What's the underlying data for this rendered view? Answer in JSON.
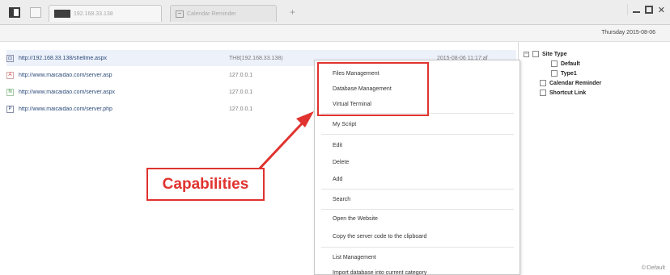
{
  "titlebar": {
    "tabs": [
      {
        "label": "192.168.33.138"
      },
      {
        "label": "Calendar Reminder"
      }
    ],
    "new_tab": "+"
  },
  "date_bar": {
    "date": "Thursday 2015-08-06"
  },
  "sites": [
    {
      "url": "http://192.168.33.138/shellme.aspx",
      "ip": "TH8(192.168.33.138)",
      "date": "2015-08-06 11:17:af",
      "icon": "aspx-icon",
      "selected": true
    },
    {
      "url": "http://www.maicaidao.com/server.asp",
      "ip": "127.0.0.1",
      "date": "",
      "icon": "asp-icon"
    },
    {
      "url": "http://www.maicaidao.com/server.aspx",
      "ip": "127.0.0.1",
      "date": "",
      "icon": "aspx-icon"
    },
    {
      "url": "http://www.maicaidao.com/server.php",
      "ip": "127.0.0.1",
      "date": "",
      "icon": "php-icon"
    }
  ],
  "context_menu": {
    "items": [
      "Files Management",
      "Database Management",
      "Virtual Terminal",
      "My Script",
      "Edit",
      "Delete",
      "Add",
      "Search",
      "Open the Website",
      "Copy the server code to the clipboard",
      "List Management",
      "Import database into current category"
    ]
  },
  "tree": {
    "root": "Site Type",
    "children": [
      "Default",
      "Type1"
    ],
    "siblings": [
      "Calendar Reminder",
      "Shortcut Link"
    ]
  },
  "annotation": {
    "callout": "Capabilities",
    "color": "#e0332f"
  },
  "status": {
    "text": "©:Default"
  }
}
